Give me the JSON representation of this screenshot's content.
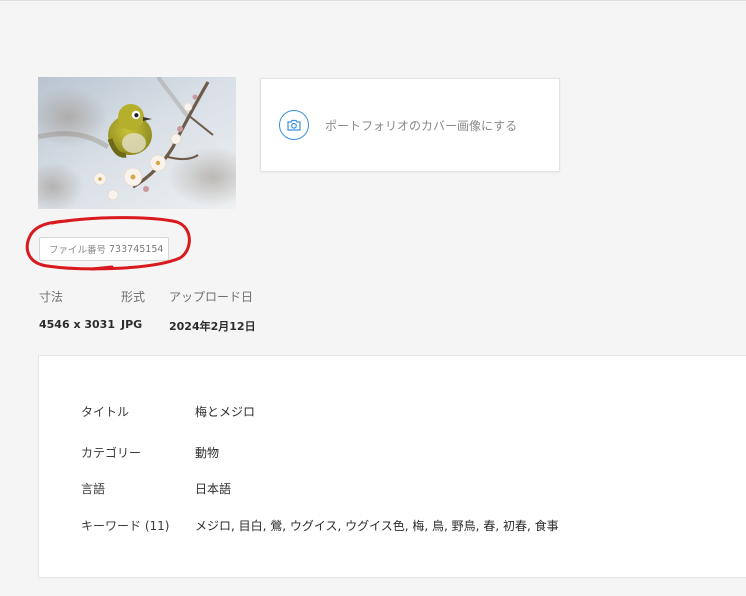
{
  "cover": {
    "label": "ポートフォリオのカバー画像にする",
    "icon": "camera-icon"
  },
  "file": {
    "label": "ファイル番号",
    "number": "733745154"
  },
  "meta": {
    "size_label": "寸法",
    "format_label": "形式",
    "upload_label": "アップロード日",
    "size_value": "4546 x 3031",
    "format_value": "JPG",
    "upload_value": "2024年2月12日"
  },
  "details": {
    "title_label": "タイトル",
    "title_value": "梅とメジロ",
    "category_label": "カテゴリー",
    "category_value": "動物",
    "language_label": "言語",
    "language_value": "日本語",
    "keywords_label": "キーワード (11)",
    "keywords_value": "メジロ, 目白, 鶯, ウグイス, ウグイス色, 梅, 鳥, 野鳥, 春, 初春, 食事"
  },
  "colors": {
    "accent": "#3d8fe0",
    "annotation": "#d8191e",
    "background": "#f5f5f5"
  }
}
